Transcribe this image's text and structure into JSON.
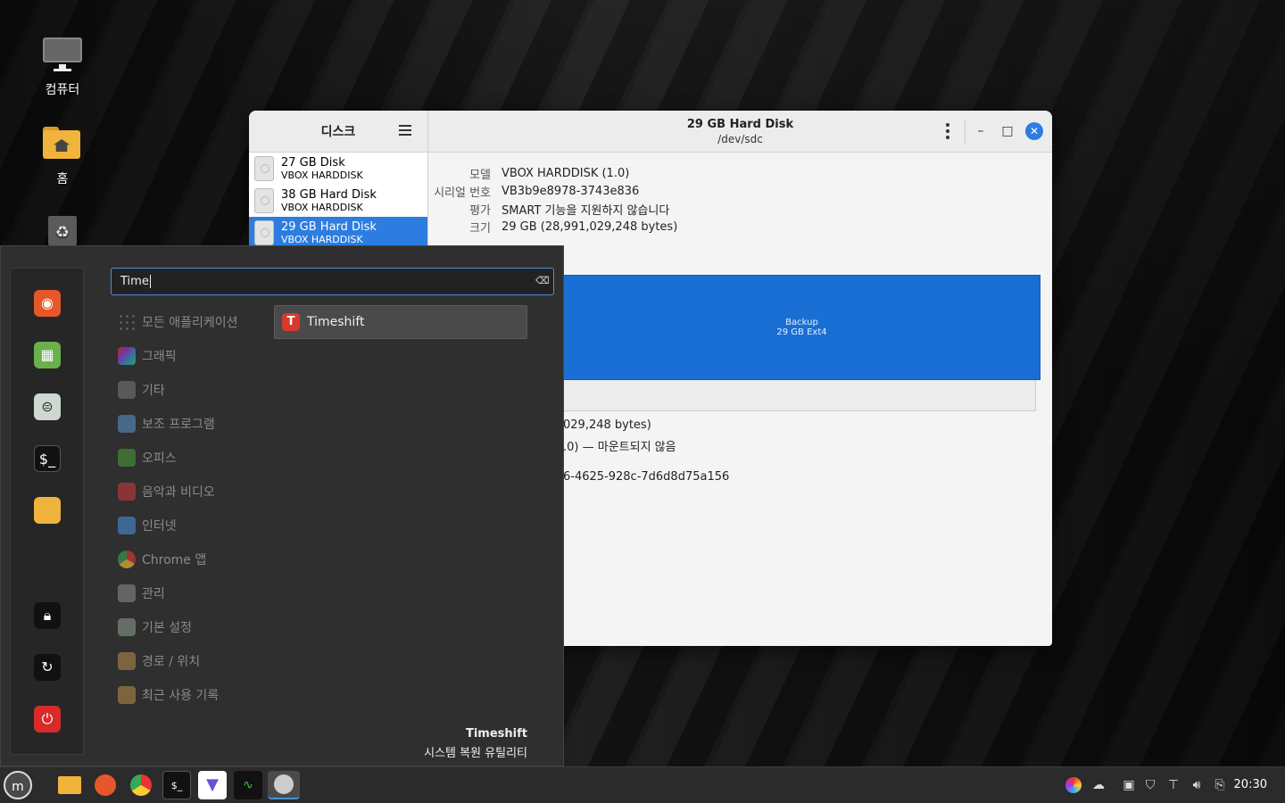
{
  "desktop": {
    "icons": [
      {
        "label": "컴퓨터",
        "icon": "computer-icon"
      },
      {
        "label": "홈",
        "icon": "home-folder-icon"
      },
      {
        "label": "",
        "icon": "trash-icon"
      }
    ]
  },
  "disks_window": {
    "sidebar_title": "디스크",
    "title": "29 GB Hard Disk",
    "subtitle": "/dev/sdc",
    "disks": [
      {
        "name": "27 GB Disk",
        "model": "VBOX HARDDISK",
        "selected": false
      },
      {
        "name": "38 GB Hard Disk",
        "model": "VBOX HARDDISK",
        "selected": false
      },
      {
        "name": "29 GB Hard Disk",
        "model": "VBOX HARDDISK",
        "selected": true
      }
    ],
    "properties": [
      {
        "key": "모델",
        "value": "VBOX HARDDISK (1.0)"
      },
      {
        "key": "시리얼 번호",
        "value": "VB3b9e8978-3743e836"
      },
      {
        "key": "평가",
        "value": "SMART 기능을 지원하지 않습니다"
      },
      {
        "key": "크기",
        "value": "29 GB (28,991,029,248 bytes)"
      }
    ],
    "partition": {
      "name": "Backup",
      "desc": "29 GB Ext4"
    },
    "partition_details_visible": [
      "029,248 bytes)",
      ".0) — 마운트되지 않음",
      "6-4625-928c-7d6d8d75a156"
    ]
  },
  "menu": {
    "search_value": "Time",
    "categories": [
      "모든 애플리케이션",
      "그래픽",
      "기타",
      "보조 프로그램",
      "오피스",
      "음악과 비디오",
      "인터넷",
      "Chrome 앱",
      "관리",
      "기본 설정",
      "경로 / 위치",
      "최근 사용 기록"
    ],
    "result": "Timeshift",
    "desc_name": "Timeshift",
    "desc_text": "시스템 복원 유틸리티"
  },
  "taskbar": {
    "clock": "20:30"
  },
  "colors": {
    "accent": "#2d7de0",
    "partition": "#1a6fd4",
    "menu_bg": "#2f2f2f"
  }
}
